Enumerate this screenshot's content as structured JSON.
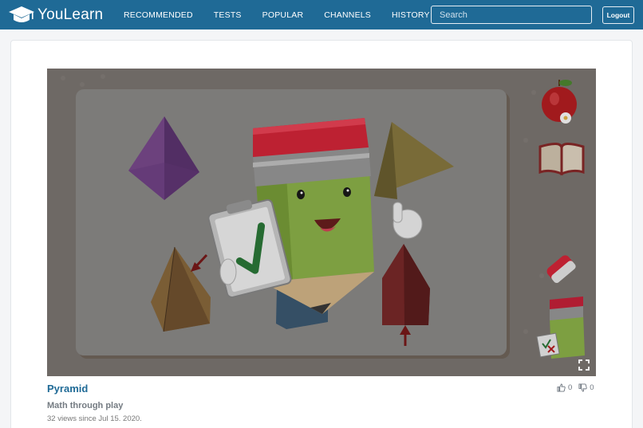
{
  "brand": {
    "name": "YouLearn",
    "icon": "graduation-cap-icon"
  },
  "nav": {
    "items": [
      "RECOMMENDED",
      "TESTS",
      "POPULAR",
      "CHANNELS",
      "HISTORY"
    ]
  },
  "search": {
    "placeholder": "Search",
    "value": ""
  },
  "account": {
    "logout_label": "Logout"
  },
  "video": {
    "title": "Pyramid",
    "channel": "Math through play",
    "meta": "32 views since Jul 15. 2020.",
    "likes": "0",
    "dislikes": "0"
  },
  "icons": {
    "like": "thumbs-up-icon",
    "dislike": "thumbs-down-icon",
    "fullscreen": "fullscreen-icon"
  },
  "colors": {
    "navbar": "#1f6a96",
    "title": "#1f6a96",
    "background": "#f4f5f7"
  }
}
